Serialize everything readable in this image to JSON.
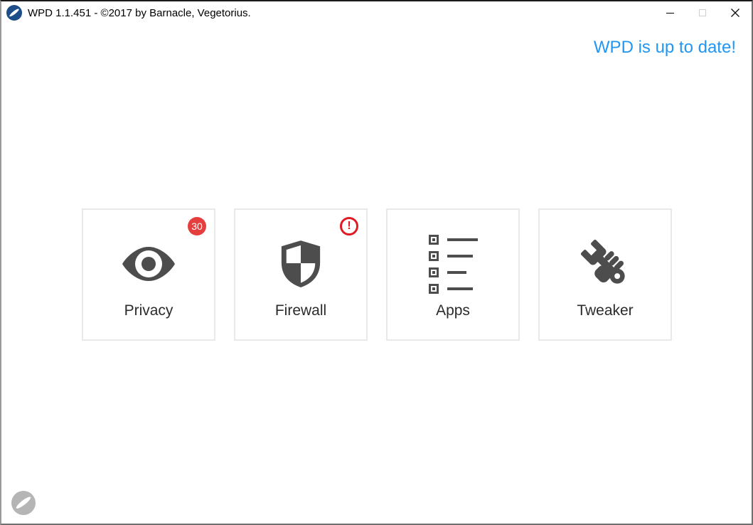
{
  "titlebar": {
    "title": "WPD 1.1.451 - ©2017 by Barnacle, Vegetorius.",
    "controls": {
      "minimize": "minimize",
      "maximize": "maximize",
      "close": "close"
    }
  },
  "status": {
    "message": "WPD is up to date!"
  },
  "cards": [
    {
      "label": "Privacy",
      "icon": "eye-icon",
      "badge_count": "30"
    },
    {
      "label": "Firewall",
      "icon": "shield-icon",
      "badge_alert": "!"
    },
    {
      "label": "Apps",
      "icon": "app-list-icon"
    },
    {
      "label": "Tweaker",
      "icon": "wrench-hand-icon"
    }
  ],
  "colors": {
    "accent_blue": "#2196f3",
    "badge_red": "#e53e3e",
    "alert_red": "#e01b24",
    "icon_gray": "#4d4d4d",
    "card_border": "#e9e9e9",
    "logo_blue": "#1d4e89",
    "logo_gray": "#b5b5b5"
  }
}
